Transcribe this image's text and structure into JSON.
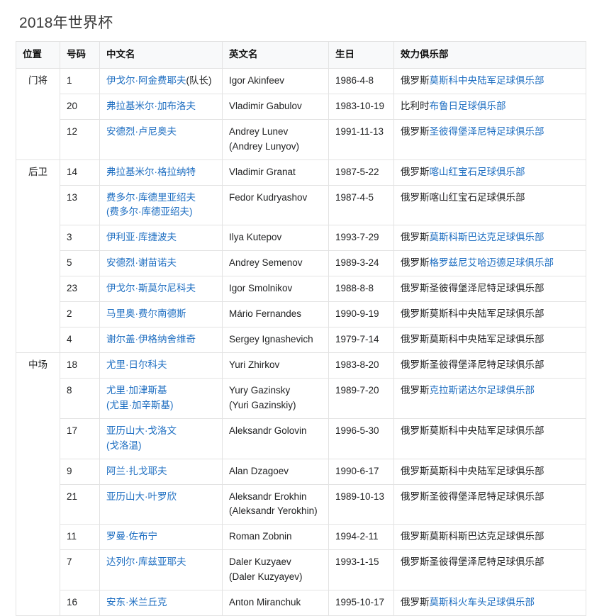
{
  "page": {
    "title": "2018年世界杯"
  },
  "table": {
    "columns": [
      "位置",
      "号码",
      "中文名",
      "英文名",
      "生日",
      "效力俱乐部"
    ],
    "rows": [
      {
        "position": "门将",
        "position_rowspan": 3,
        "number": "1",
        "cn_name": "伊戈尔·阿金费耶夫",
        "cn_name_suffix": "(队长)",
        "cn_name_alt": "",
        "en_name": "Igor Akinfeev",
        "en_name_alt": "",
        "birthday": "1986-4-8",
        "club_prefix": "俄罗斯",
        "club_link": "莫斯科中央陆军足球俱乐部",
        "club_plain": ""
      },
      {
        "position": "",
        "number": "20",
        "cn_name": "弗拉基米尔·加布洛夫",
        "cn_name_suffix": "",
        "cn_name_alt": "",
        "en_name": "Vladimir Gabulov",
        "en_name_alt": "",
        "birthday": "1983-10-19",
        "club_prefix": "比利时",
        "club_link": "布鲁日足球俱乐部",
        "club_plain": ""
      },
      {
        "position": "",
        "number": "12",
        "cn_name": "安德烈·卢尼奥夫",
        "cn_name_suffix": "",
        "cn_name_alt": "",
        "en_name": "Andrey Lunev",
        "en_name_alt": "(Andrey Lunyov)",
        "birthday": "1991-11-13",
        "club_prefix": "俄罗斯",
        "club_link": "圣彼得堡泽尼特足球俱乐部",
        "club_plain": ""
      },
      {
        "position": "后卫",
        "position_rowspan": 7,
        "number": "14",
        "cn_name": "弗拉基米尔·格拉纳特",
        "cn_name_suffix": "",
        "cn_name_alt": "",
        "en_name": "Vladimir Granat",
        "en_name_alt": "",
        "birthday": "1987-5-22",
        "club_prefix": "俄罗斯",
        "club_link": "喀山红宝石足球俱乐部",
        "club_plain": ""
      },
      {
        "position": "",
        "number": "13",
        "cn_name": "费多尔·库德里亚绍夫",
        "cn_name_suffix": "",
        "cn_name_alt": "(费多尔·库德亚绍夫)",
        "en_name": "Fedor Kudryashov",
        "en_name_alt": "",
        "birthday": "1987-4-5",
        "club_prefix": "",
        "club_link": "",
        "club_plain": "俄罗斯喀山红宝石足球俱乐部"
      },
      {
        "position": "",
        "number": "3",
        "cn_name": "伊利亚·库捷波夫",
        "cn_name_suffix": "",
        "cn_name_alt": "",
        "en_name": "Ilya Kutepov",
        "en_name_alt": "",
        "birthday": "1993-7-29",
        "club_prefix": "俄罗斯",
        "club_link": "莫斯科斯巴达克足球俱乐部",
        "club_plain": ""
      },
      {
        "position": "",
        "number": "5",
        "cn_name": "安德烈·谢苗诺夫",
        "cn_name_suffix": "",
        "cn_name_alt": "",
        "en_name": "Andrey Semenov",
        "en_name_alt": "",
        "birthday": "1989-3-24",
        "club_prefix": "俄罗斯",
        "club_link": "格罗兹尼艾哈迈德足球俱乐部",
        "club_plain": ""
      },
      {
        "position": "",
        "number": "23",
        "cn_name": "伊戈尔·斯莫尔尼科夫",
        "cn_name_suffix": "",
        "cn_name_alt": "",
        "en_name": "Igor Smolnikov",
        "en_name_alt": "",
        "birthday": "1988-8-8",
        "club_prefix": "",
        "club_link": "",
        "club_plain": "俄罗斯圣彼得堡泽尼特足球俱乐部"
      },
      {
        "position": "",
        "number": "2",
        "cn_name": "马里奥·费尔南德斯",
        "cn_name_suffix": "",
        "cn_name_alt": "",
        "en_name": "Mário Fernandes",
        "en_name_alt": "",
        "birthday": "1990-9-19",
        "club_prefix": "",
        "club_link": "",
        "club_plain": "俄罗斯莫斯科中央陆军足球俱乐部"
      },
      {
        "position": "",
        "number": "4",
        "cn_name": "谢尔盖·伊格纳舍维奇",
        "cn_name_suffix": "",
        "cn_name_alt": "",
        "en_name": "Sergey Ignashevich",
        "en_name_alt": "",
        "birthday": "1979-7-14",
        "club_prefix": "",
        "club_link": "",
        "club_plain": "俄罗斯莫斯科中央陆军足球俱乐部"
      },
      {
        "position": "中场",
        "position_rowspan": 8,
        "number": "18",
        "cn_name": "尤里·日尔科夫",
        "cn_name_suffix": "",
        "cn_name_alt": "",
        "en_name": "Yuri Zhirkov",
        "en_name_alt": "",
        "birthday": "1983-8-20",
        "club_prefix": "",
        "club_link": "",
        "club_plain": "俄罗斯圣彼得堡泽尼特足球俱乐部"
      },
      {
        "position": "",
        "number": "8",
        "cn_name": "尤里·加津斯基",
        "cn_name_suffix": "",
        "cn_name_alt": "(尤里·加辛斯基)",
        "en_name": "Yury Gazinsky",
        "en_name_alt": "(Yuri Gazinskiy)",
        "birthday": "1989-7-20",
        "club_prefix": "俄罗斯",
        "club_link": "克拉斯诺达尔足球俱乐部",
        "club_plain": ""
      },
      {
        "position": "",
        "number": "17",
        "cn_name": "亚历山大·戈洛文",
        "cn_name_suffix": "",
        "cn_name_alt": "(戈洛温)",
        "en_name": "Aleksandr Golovin",
        "en_name_alt": "",
        "birthday": "1996-5-30",
        "club_prefix": "",
        "club_link": "",
        "club_plain": "俄罗斯莫斯科中央陆军足球俱乐部"
      },
      {
        "position": "",
        "number": "9",
        "cn_name": "阿兰·扎戈耶夫",
        "cn_name_suffix": "",
        "cn_name_alt": "",
        "en_name": "Alan Dzagoev",
        "en_name_alt": "",
        "birthday": "1990-6-17",
        "club_prefix": "",
        "club_link": "",
        "club_plain": "俄罗斯莫斯科中央陆军足球俱乐部"
      },
      {
        "position": "",
        "number": "21",
        "cn_name": "亚历山大·叶罗欣",
        "cn_name_suffix": "",
        "cn_name_alt": "",
        "en_name": "Aleksandr Erokhin",
        "en_name_alt": "(Aleksandr Yerokhin)",
        "birthday": "1989-10-13",
        "club_prefix": "",
        "club_link": "",
        "club_plain": "俄罗斯圣彼得堡泽尼特足球俱乐部"
      },
      {
        "position": "",
        "number": "11",
        "cn_name": "罗曼·佐布宁",
        "cn_name_suffix": "",
        "cn_name_alt": "",
        "en_name": "Roman Zobnin",
        "en_name_alt": "",
        "birthday": "1994-2-11",
        "club_prefix": "",
        "club_link": "",
        "club_plain": "俄罗斯莫斯科斯巴达克足球俱乐部"
      },
      {
        "position": "",
        "number": "7",
        "cn_name": "达列尔·库兹亚耶夫",
        "cn_name_suffix": "",
        "cn_name_alt": "",
        "en_name": "Daler Kuzyaev",
        "en_name_alt": "(Daler Kuzyayev)",
        "birthday": "1993-1-15",
        "club_prefix": "",
        "club_link": "",
        "club_plain": "俄罗斯圣彼得堡泽尼特足球俱乐部"
      },
      {
        "position": "",
        "number": "16",
        "cn_name": "安东·米兰丘克",
        "cn_name_suffix": "",
        "cn_name_alt": "",
        "en_name": "Anton Miranchuk",
        "en_name_alt": "",
        "birthday": "1995-10-17",
        "club_prefix": "俄罗斯",
        "club_link": "莫斯科火车头足球俱乐部",
        "club_plain": ""
      }
    ]
  },
  "colors": {
    "link": "#1c6dc1",
    "text": "#202122",
    "header_bg": "#f8f9fa",
    "border": "#e3e3e3"
  }
}
